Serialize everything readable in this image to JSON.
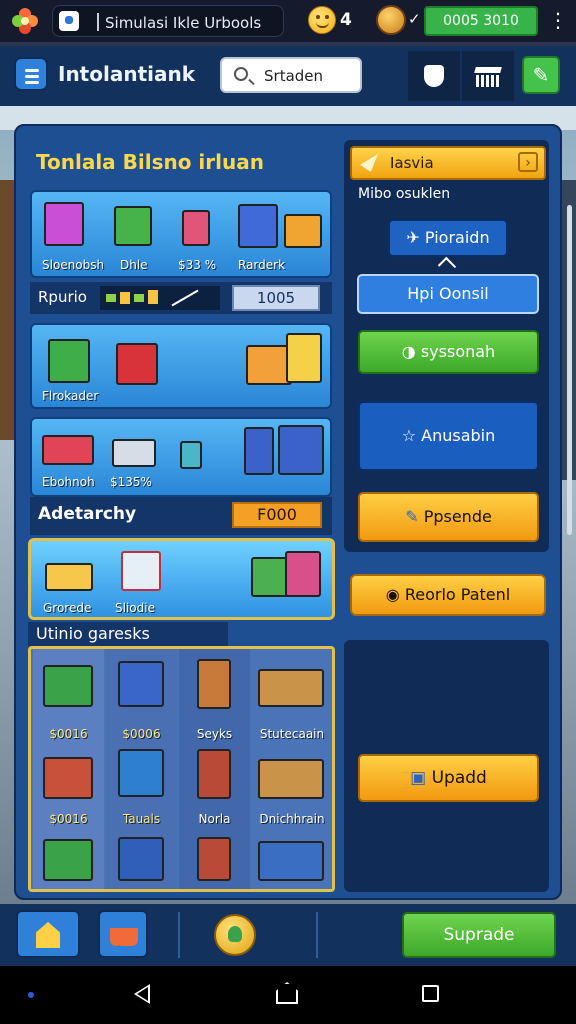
{
  "status_bar": {
    "tab_title": "Simulasi Ikle Urbools",
    "hp": "4",
    "coins": "0005 3010"
  },
  "header": {
    "title": "Intolantiank",
    "search_placeholder": "Srtaden"
  },
  "panel": {
    "title": "Tonlala Bilsno irluan",
    "card1": {
      "labels": [
        "Sloenobsh",
        "Dhle",
        "$33 %",
        "Rarderk"
      ]
    },
    "resources": {
      "label": "Rpurio",
      "value": "1005"
    },
    "card2": {
      "label": "Flrokader"
    },
    "card3": {
      "labels": [
        "Ebohnoh",
        "$135%"
      ]
    },
    "advertising": {
      "label": "Adetarchy",
      "value": "F000"
    },
    "card4": {
      "labels": [
        "Grorede",
        "Sliodie"
      ]
    },
    "inventory": {
      "title": "Utinio garesks",
      "labels": [
        [
          "$0016",
          "$0016"
        ],
        [
          "$0006",
          "Tauals"
        ],
        [
          "Seyks",
          "Norla"
        ],
        [
          "Stutecaain",
          "Dnichhrain"
        ]
      ]
    }
  },
  "right": {
    "top_button": "Iasvia",
    "subheading": "Mibo osuklen",
    "provider": "Pioraidn",
    "department": "Hpi Oonsil",
    "system": "syssonah",
    "achievement": "Anusabin",
    "expenditure": "Ppsende",
    "report": "Reorlo Patenl",
    "upgrade": "Upadd"
  },
  "bottom": {
    "upgrade": "Suprade"
  },
  "colors": {
    "panel_blue": "#1d4f92",
    "accent_gold": "#ffd84a",
    "green": "#3da82a",
    "orange": "#f19a10"
  }
}
